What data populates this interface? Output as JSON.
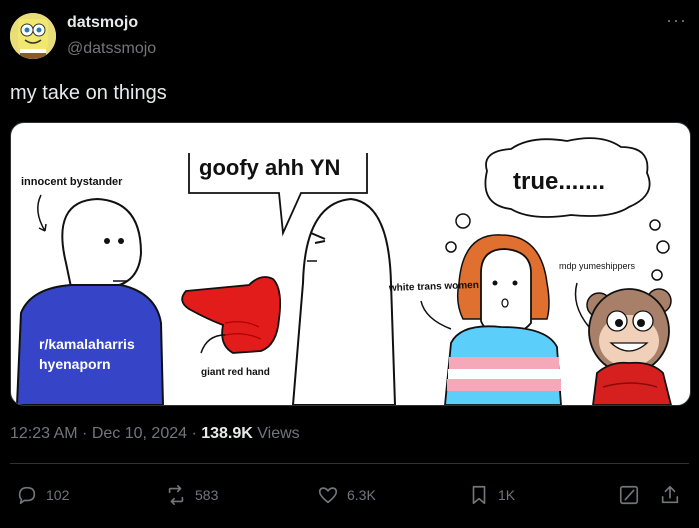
{
  "user": {
    "display_name": "datsmojo",
    "handle": "@datssmojo"
  },
  "more_label": "···",
  "tweet": {
    "text": "my take on things"
  },
  "image": {
    "labels": {
      "innocent_bystander": "innocent bystander",
      "goofy": "goofy ahh YN",
      "true": "true.......",
      "kamala_line1": "r/kamalaharris",
      "kamala_line2": "hyenaporn",
      "giant_red_hand": "giant red hand",
      "white_trans_women": "white trans women",
      "mdp": "mdp yumeshippers"
    }
  },
  "meta": {
    "time": "12:23 AM",
    "sep1": " · ",
    "date": "Dec 10, 2024",
    "sep2": " · ",
    "views_count": "138.9K",
    "views_label": " Views"
  },
  "actions": {
    "replies": "102",
    "reposts": "583",
    "likes": "6.3K",
    "bookmarks": "1K"
  },
  "colors": {
    "background": "#000000",
    "text_primary": "#e7e9ea",
    "text_secondary": "#71767b",
    "divider": "#2f3336"
  }
}
